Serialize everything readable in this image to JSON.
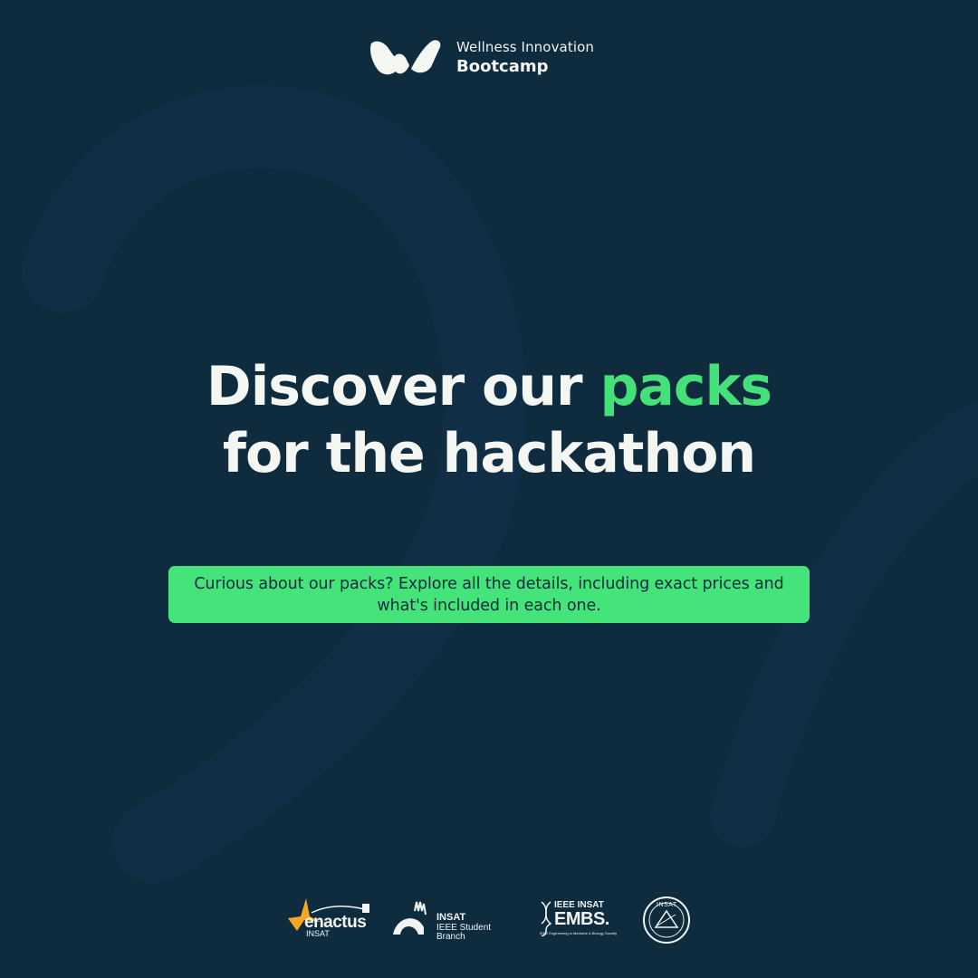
{
  "brand": {
    "line1": "Wellness Innovation",
    "line2": "Bootcamp",
    "logo_icon": "w-logo-icon"
  },
  "headline": {
    "part1": "Discover our ",
    "accent": "packs",
    "line2": "for the hackathon"
  },
  "info": {
    "text": "Curious about our packs? Explore all the details, including exact prices and what's included in each one."
  },
  "partners": {
    "enactus": {
      "name": "enactus",
      "sub": "INSAT"
    },
    "ieee": {
      "title": "INSAT",
      "sub": "IEEE Student Branch"
    },
    "embs": {
      "top": "IEEE INSAT",
      "main": "EMBS.",
      "sub": "IEEE Engineering in Medicine & Biology Society"
    },
    "insat_seal": {
      "text": "INSAT"
    }
  },
  "colors": {
    "background": "#0f2c3f",
    "accent": "#46e07a",
    "text": "#f4f6f2"
  }
}
